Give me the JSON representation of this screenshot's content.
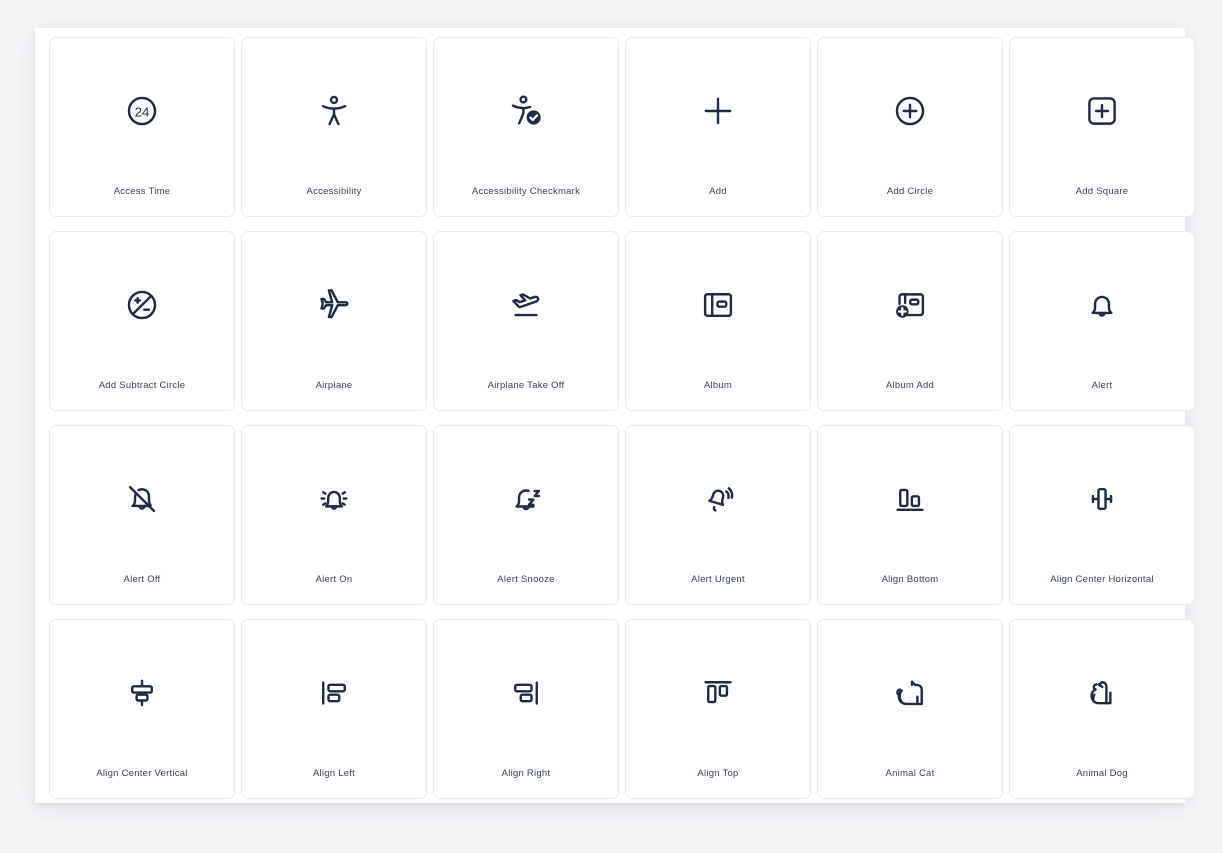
{
  "page": {
    "background_color": "#f4f5f7",
    "surface_color": "#ffffff",
    "card_border_color": "#e8eaee",
    "icon_color": "#1f2a44",
    "label_color": "#3c4257",
    "columns": 6,
    "rows": 4
  },
  "icons": [
    {
      "label": "Access Time",
      "icon_name": "access-time-icon"
    },
    {
      "label": "Accessibility",
      "icon_name": "accessibility-icon"
    },
    {
      "label": "Accessibility Checkmark",
      "icon_name": "accessibility-checkmark-icon"
    },
    {
      "label": "Add",
      "icon_name": "add-icon"
    },
    {
      "label": "Add Circle",
      "icon_name": "add-circle-icon"
    },
    {
      "label": "Add Square",
      "icon_name": "add-square-icon"
    },
    {
      "label": "Add Subtract Circle",
      "icon_name": "add-subtract-circle-icon"
    },
    {
      "label": "Airplane",
      "icon_name": "airplane-icon"
    },
    {
      "label": "Airplane Take Off",
      "icon_name": "airplane-take-off-icon"
    },
    {
      "label": "Album",
      "icon_name": "album-icon"
    },
    {
      "label": "Album Add",
      "icon_name": "album-add-icon"
    },
    {
      "label": "Alert",
      "icon_name": "alert-icon"
    },
    {
      "label": "Alert Off",
      "icon_name": "alert-off-icon"
    },
    {
      "label": "Alert On",
      "icon_name": "alert-on-icon"
    },
    {
      "label": "Alert Snooze",
      "icon_name": "alert-snooze-icon"
    },
    {
      "label": "Alert Urgent",
      "icon_name": "alert-urgent-icon"
    },
    {
      "label": "Align Bottom",
      "icon_name": "align-bottom-icon"
    },
    {
      "label": "Align Center Horizontal",
      "icon_name": "align-center-horizontal-icon"
    },
    {
      "label": "Align Center Vertical",
      "icon_name": "align-center-vertical-icon"
    },
    {
      "label": "Align Left",
      "icon_name": "align-left-icon"
    },
    {
      "label": "Align Right",
      "icon_name": "align-right-icon"
    },
    {
      "label": "Align Top",
      "icon_name": "align-top-icon"
    },
    {
      "label": "Animal Cat",
      "icon_name": "animal-cat-icon"
    },
    {
      "label": "Animal Dog",
      "icon_name": "animal-dog-icon"
    }
  ]
}
